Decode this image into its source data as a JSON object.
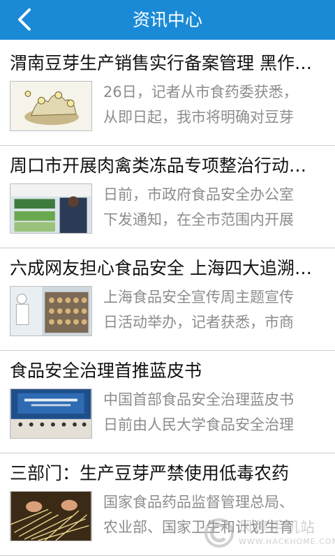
{
  "header": {
    "title": "资讯中心",
    "back_icon": "chevron-left-icon",
    "color": "#1b8ad6"
  },
  "news": [
    {
      "title": "渭南豆芽生产销售实行备案管理 黑作坊要遭严打",
      "summary_line1": "26日，记者从市食药委获悉，",
      "summary_line2": "从即日起，我市将明确对豆芽"
    },
    {
      "title": "周口市开展肉禽类冻品专项整治行动保障食品安全",
      "summary_line1": "日前，市政府食品安全办公室",
      "summary_line2": "下发通知，在全市范围内开展"
    },
    {
      "title": "六成网友担心食品安全 上海四大追溯系统即将上线",
      "summary_line1": "上海食品安全宣传周主题宣传",
      "summary_line2": "日活动举办，记者获悉，市商"
    },
    {
      "title": "食品安全治理首推蓝皮书",
      "summary_line1": "中国首部食品安全治理蓝皮书",
      "summary_line2": "日前由人民大学食品安全治理"
    },
    {
      "title": "三部门：生产豆芽严禁使用低毒农药",
      "summary_line1": "国家食品药品监督管理总局、",
      "summary_line2": "农业部、国家卫生和计划生育"
    }
  ],
  "watermark": {
    "text": "风停手机站",
    "url": "WWW.HACKHOME.COM"
  }
}
